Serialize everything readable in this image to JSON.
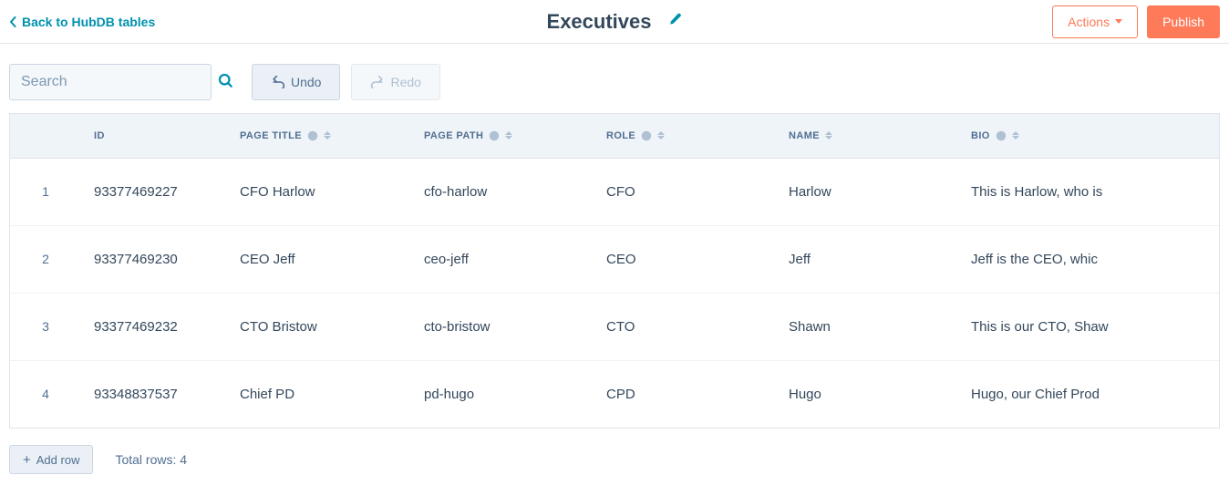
{
  "header": {
    "back_label": "Back to HubDB tables",
    "title": "Executives",
    "actions_label": "Actions",
    "publish_label": "Publish"
  },
  "toolbar": {
    "search_placeholder": "Search",
    "undo_label": "Undo",
    "redo_label": "Redo"
  },
  "columns": {
    "id": "ID",
    "page_title": "PAGE TITLE",
    "page_path": "PAGE PATH",
    "role": "ROLE",
    "name": "NAME",
    "bio": "BIO"
  },
  "rows": [
    {
      "num": "1",
      "id": "93377469227",
      "page_title": "CFO Harlow",
      "page_path": "cfo-harlow",
      "role": "CFO",
      "name": "Harlow",
      "bio": "This is Harlow, who is"
    },
    {
      "num": "2",
      "id": "93377469230",
      "page_title": "CEO Jeff",
      "page_path": "ceo-jeff",
      "role": "CEO",
      "name": "Jeff",
      "bio": "Jeff is the CEO, whic"
    },
    {
      "num": "3",
      "id": "93377469232",
      "page_title": "CTO Bristow",
      "page_path": "cto-bristow",
      "role": "CTO",
      "name": "Shawn",
      "bio": "This is our CTO, Shaw"
    },
    {
      "num": "4",
      "id": "93348837537",
      "page_title": "Chief PD",
      "page_path": "pd-hugo",
      "role": "CPD",
      "name": "Hugo",
      "bio": "Hugo, our Chief Prod"
    }
  ],
  "footer": {
    "add_row_label": "Add row",
    "total_rows_label": "Total rows: 4"
  }
}
